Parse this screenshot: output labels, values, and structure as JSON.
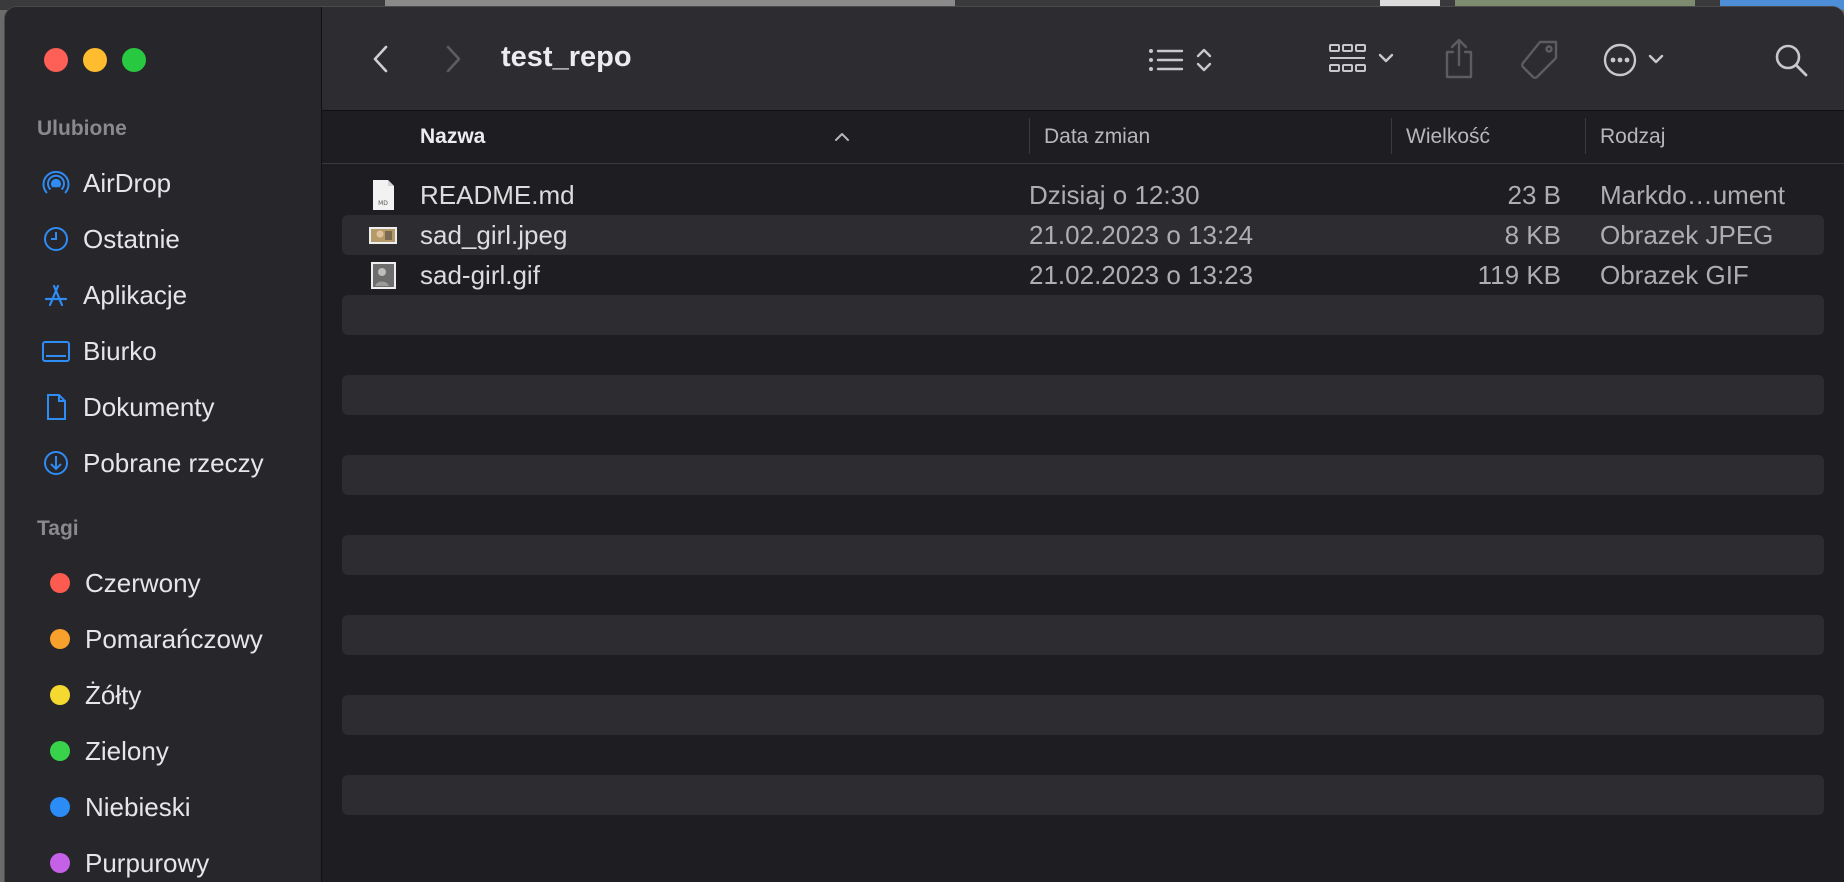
{
  "window": {
    "title": "test_repo"
  },
  "sidebar": {
    "favorites_title": "Ulubione",
    "favorites": [
      {
        "label": "AirDrop",
        "icon": "airdrop-icon"
      },
      {
        "label": "Ostatnie",
        "icon": "clock-icon"
      },
      {
        "label": "Aplikacje",
        "icon": "applications-icon"
      },
      {
        "label": "Biurko",
        "icon": "desktop-icon"
      },
      {
        "label": "Dokumenty",
        "icon": "document-icon"
      },
      {
        "label": "Pobrane rzeczy",
        "icon": "download-icon"
      }
    ],
    "tags_title": "Tagi",
    "tags": [
      {
        "label": "Czerwony",
        "color": "#fe5b50"
      },
      {
        "label": "Pomarańczowy",
        "color": "#f7a02c"
      },
      {
        "label": "Żółty",
        "color": "#f6d930"
      },
      {
        "label": "Zielony",
        "color": "#38d34a"
      },
      {
        "label": "Niebieski",
        "color": "#2b8cf6"
      },
      {
        "label": "Purpurowy",
        "color": "#c561e6"
      }
    ]
  },
  "columns": {
    "name": "Nazwa",
    "date": "Data zmian",
    "size": "Wielkość",
    "kind": "Rodzaj"
  },
  "files": [
    {
      "name": "README.md",
      "date": "Dzisiaj o 12:30",
      "size": "23 B",
      "kind": "Markdo…ument",
      "icon": "markdown-file-icon"
    },
    {
      "name": "sad_girl.jpeg",
      "date": "21.02.2023 o 13:24",
      "size": "8 KB",
      "kind": "Obrazek JPEG",
      "icon": "jpeg-thumbnail-icon"
    },
    {
      "name": "sad-girl.gif",
      "date": "21.02.2023 o 13:23",
      "size": "119 KB",
      "kind": "Obrazek GIF",
      "icon": "gif-thumbnail-icon"
    }
  ],
  "accent": "#2f8cf4"
}
